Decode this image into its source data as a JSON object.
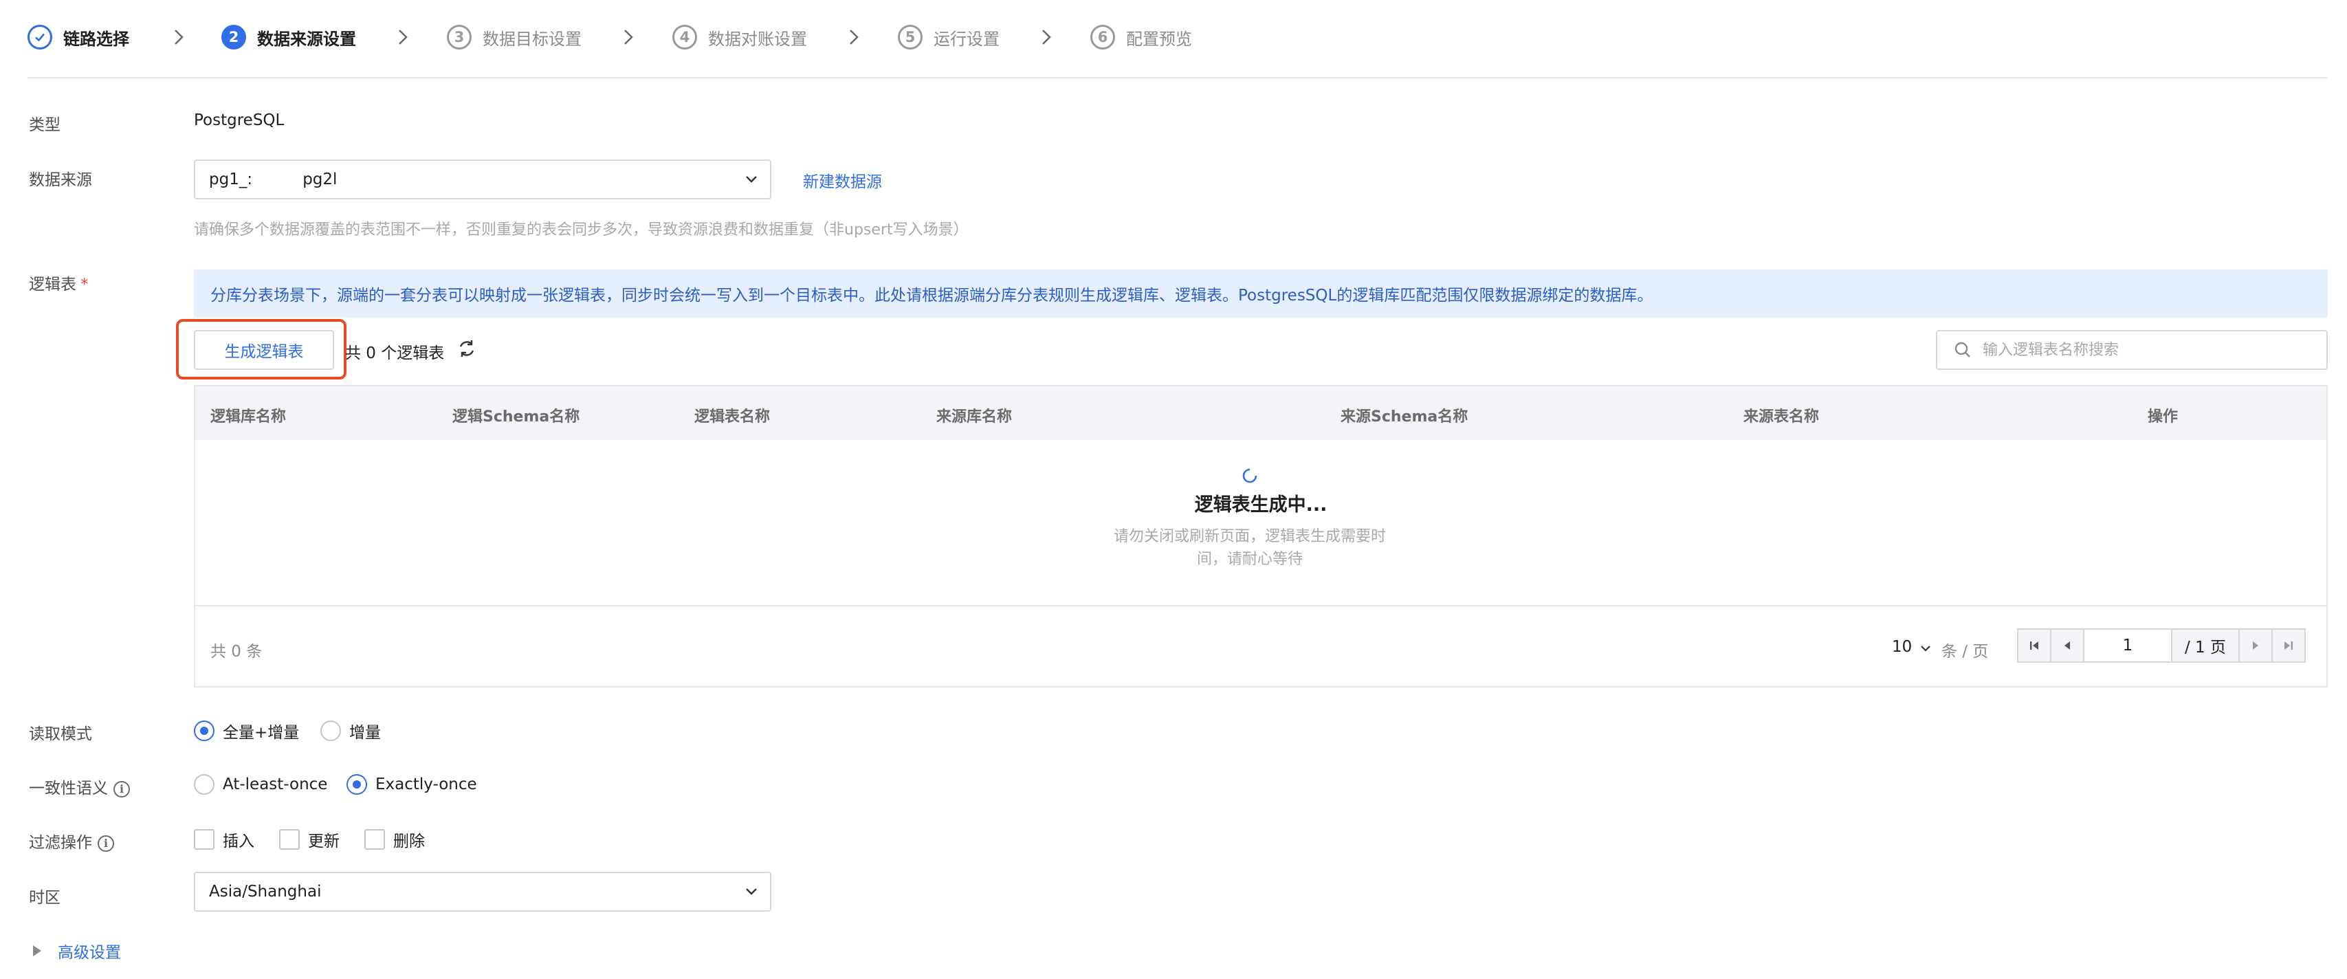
{
  "stepper": {
    "steps": [
      {
        "num": "✓",
        "label": "链路选择",
        "state": "done"
      },
      {
        "num": "2",
        "label": "数据来源设置",
        "state": "active"
      },
      {
        "num": "3",
        "label": "数据目标设置",
        "state": "todo"
      },
      {
        "num": "4",
        "label": "数据对账设置",
        "state": "todo"
      },
      {
        "num": "5",
        "label": "运行设置",
        "state": "todo"
      },
      {
        "num": "6",
        "label": "配置预览",
        "state": "todo"
      }
    ]
  },
  "form": {
    "type": {
      "label": "类型",
      "value": "PostgreSQL"
    },
    "source": {
      "label": "数据来源",
      "value": "pg1_:          pg2l",
      "new_link": "新建数据源",
      "hint": "请确保多个数据源覆盖的表范围不一样，否则重复的表会同步多次，导致资源浪费和数据重复（非upsert写入场景）"
    },
    "logic_table": {
      "label": "逻辑表",
      "required_mark": "*",
      "notice": "分库分表场景下，源端的一套分表可以映射成一张逻辑表，同步时会统一写入到一个目标表中。此处请根据源端分库分表规则生成逻辑库、逻辑表。PostgresSQL的逻辑库匹配范围仅限数据源绑定的数据库。",
      "generate_button": "生成逻辑表",
      "count_text": "共 0 个逻辑表",
      "search_placeholder": "输入逻辑表名称搜索"
    },
    "read_mode": {
      "label": "读取模式",
      "options": [
        "全量+增量",
        "增量"
      ],
      "selected": "全量+增量"
    },
    "consistency": {
      "label": "一致性语义",
      "options": [
        "At-least-once",
        "Exactly-once"
      ],
      "selected": "Exactly-once"
    },
    "filter": {
      "label": "过滤操作",
      "options": [
        "插入",
        "更新",
        "删除"
      ]
    },
    "timezone": {
      "label": "时区",
      "value": "Asia/Shanghai"
    },
    "advanced": {
      "label": "高级设置"
    }
  },
  "table": {
    "columns": [
      "逻辑库名称",
      "逻辑Schema名称",
      "逻辑表名称",
      "来源库名称",
      "来源Schema名称",
      "来源表名称",
      "操作"
    ],
    "empty_title": "逻辑表生成中...",
    "empty_desc": "请勿关闭或刷新页面，逻辑表生成需要时间，请耐心等待",
    "total_text": "共 0 条",
    "page_size": "10",
    "page_unit": "条 / 页",
    "current_page": "1",
    "total_pages": "/ 1 页"
  },
  "colors": {
    "accent": "#2f6ee5",
    "highlight": "#e64c1e",
    "notice_bg": "#e5effe"
  }
}
